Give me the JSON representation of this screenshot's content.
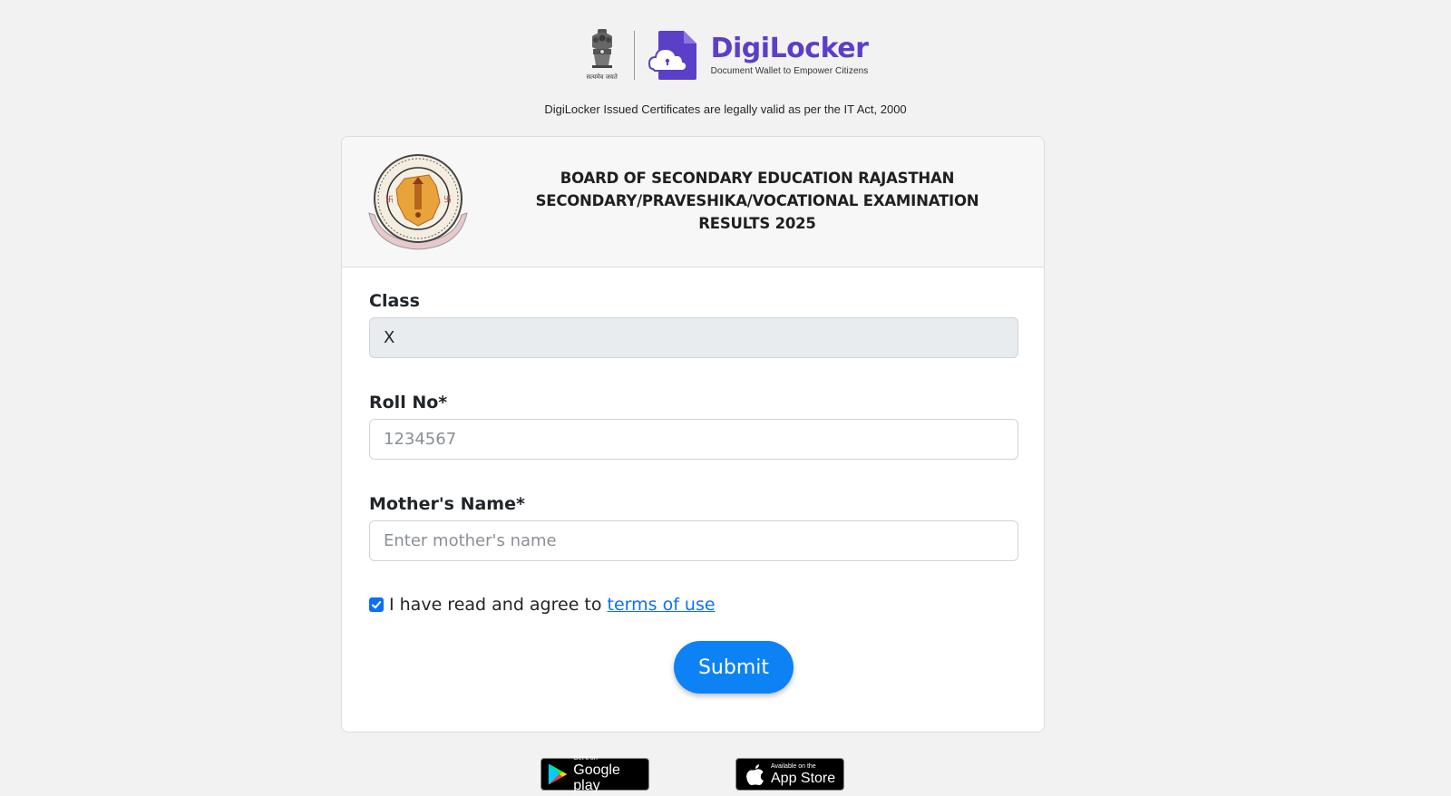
{
  "header": {
    "emblem_caption": "सत्यमेव जयते",
    "brand_name": "DigiLocker",
    "brand_tagline": "Document Wallet to Empower Citizens",
    "legal_note": "DigiLocker Issued Certificates are legally valid as per the IT Act, 2000"
  },
  "card": {
    "title_lines": [
      "BOARD OF SECONDARY EDUCATION RAJASTHAN",
      "SECONDARY/PRAVESHIKA/VOCATIONAL EXAMINATION",
      "RESULTS 2025"
    ],
    "seal_icon": "board-seal"
  },
  "form": {
    "class_label": "Class",
    "class_value": "X",
    "roll_label": "Roll No*",
    "roll_placeholder": "1234567",
    "mother_label": "Mother's Name*",
    "mother_placeholder": "Enter mother's name",
    "agree_text": "I have read and agree to",
    "agree_checked": true,
    "terms_link": "terms of use",
    "submit_label": "Submit"
  },
  "stores": {
    "google_small": "Get it on",
    "google_big": "Google play",
    "apple_small": "Available on the",
    "apple_big": "App Store"
  },
  "colors": {
    "brand_purple": "#5b3fc8",
    "primary_blue": "#0d82f5",
    "link_blue": "#0d6efd",
    "page_bg": "#f2f2f2"
  }
}
